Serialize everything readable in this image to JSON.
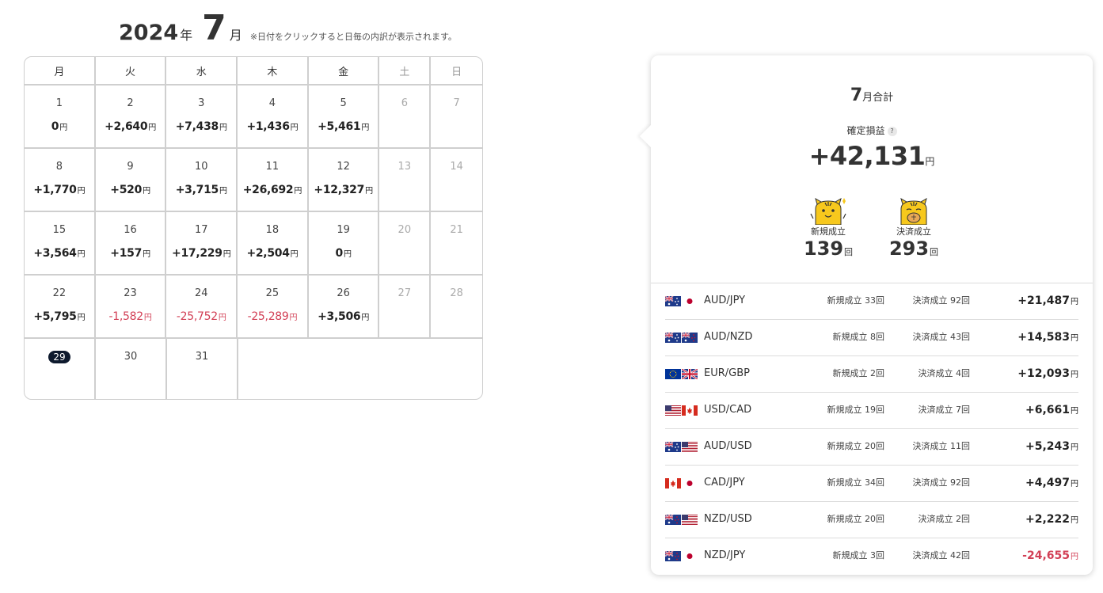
{
  "header": {
    "year": "2024",
    "year_unit": "年",
    "month": "7",
    "month_unit": "月",
    "note": "※日付をクリックすると日毎の内訳が表示されます。"
  },
  "calendar": {
    "weekdays": [
      "月",
      "火",
      "水",
      "木",
      "金",
      "土",
      "日"
    ],
    "yen": "円",
    "weeks": [
      [
        {
          "day": "1",
          "pnl": "0",
          "neg": false
        },
        {
          "day": "2",
          "pnl": "+2,640",
          "neg": false
        },
        {
          "day": "3",
          "pnl": "+7,438",
          "neg": false
        },
        {
          "day": "4",
          "pnl": "+1,436",
          "neg": false
        },
        {
          "day": "5",
          "pnl": "+5,461",
          "neg": false
        },
        {
          "day": "6",
          "pnl": "",
          "neg": false
        },
        {
          "day": "7",
          "pnl": "",
          "neg": false
        }
      ],
      [
        {
          "day": "8",
          "pnl": "+1,770",
          "neg": false
        },
        {
          "day": "9",
          "pnl": "+520",
          "neg": false
        },
        {
          "day": "10",
          "pnl": "+3,715",
          "neg": false
        },
        {
          "day": "11",
          "pnl": "+26,692",
          "neg": false
        },
        {
          "day": "12",
          "pnl": "+12,327",
          "neg": false
        },
        {
          "day": "13",
          "pnl": "",
          "neg": false
        },
        {
          "day": "14",
          "pnl": "",
          "neg": false
        }
      ],
      [
        {
          "day": "15",
          "pnl": "+3,564",
          "neg": false
        },
        {
          "day": "16",
          "pnl": "+157",
          "neg": false
        },
        {
          "day": "17",
          "pnl": "+17,229",
          "neg": false
        },
        {
          "day": "18",
          "pnl": "+2,504",
          "neg": false
        },
        {
          "day": "19",
          "pnl": "0",
          "neg": false
        },
        {
          "day": "20",
          "pnl": "",
          "neg": false
        },
        {
          "day": "21",
          "pnl": "",
          "neg": false
        }
      ],
      [
        {
          "day": "22",
          "pnl": "+5,795",
          "neg": false
        },
        {
          "day": "23",
          "pnl": "-1,582",
          "neg": true
        },
        {
          "day": "24",
          "pnl": "-25,752",
          "neg": true
        },
        {
          "day": "25",
          "pnl": "-25,289",
          "neg": true
        },
        {
          "day": "26",
          "pnl": "+3,506",
          "neg": false
        },
        {
          "day": "27",
          "pnl": "",
          "neg": false
        },
        {
          "day": "28",
          "pnl": "",
          "neg": false
        }
      ],
      [
        {
          "day": "29",
          "pnl": "",
          "neg": false,
          "today": true
        },
        {
          "day": "30",
          "pnl": "",
          "neg": false
        },
        {
          "day": "31",
          "pnl": "",
          "neg": false
        }
      ]
    ]
  },
  "summary": {
    "month": "7",
    "month_total_label": "月合計",
    "pl_label": "確定損益",
    "help_glyph": "?",
    "pl_value": "+42,131",
    "yen": "円",
    "new_label": "新規成立",
    "new_count": "139",
    "close_label": "決済成立",
    "close_count": "293",
    "count_unit": "回",
    "pairs": [
      {
        "name": "AUD/JPY",
        "flags": [
          "au",
          "jp"
        ],
        "new": "新規成立 33回",
        "close": "決済成立 92回",
        "pl": "+21,487",
        "neg": false
      },
      {
        "name": "AUD/NZD",
        "flags": [
          "au",
          "nz"
        ],
        "new": "新規成立 8回",
        "close": "決済成立 43回",
        "pl": "+14,583",
        "neg": false
      },
      {
        "name": "EUR/GBP",
        "flags": [
          "eu",
          "gb"
        ],
        "new": "新規成立 2回",
        "close": "決済成立 4回",
        "pl": "+12,093",
        "neg": false
      },
      {
        "name": "USD/CAD",
        "flags": [
          "us",
          "ca"
        ],
        "new": "新規成立 19回",
        "close": "決済成立 7回",
        "pl": "+6,661",
        "neg": false
      },
      {
        "name": "AUD/USD",
        "flags": [
          "au",
          "us"
        ],
        "new": "新規成立 20回",
        "close": "決済成立 11回",
        "pl": "+5,243",
        "neg": false
      },
      {
        "name": "CAD/JPY",
        "flags": [
          "ca",
          "jp"
        ],
        "new": "新規成立 34回",
        "close": "決済成立 92回",
        "pl": "+4,497",
        "neg": false
      },
      {
        "name": "NZD/USD",
        "flags": [
          "nz",
          "us"
        ],
        "new": "新規成立 20回",
        "close": "決済成立 2回",
        "pl": "+2,222",
        "neg": false
      },
      {
        "name": "NZD/JPY",
        "flags": [
          "nz",
          "jp"
        ],
        "new": "新規成立 3回",
        "close": "決済成立 42回",
        "pl": "-24,655",
        "neg": true
      }
    ]
  },
  "colors": {
    "negative": "#d23f55",
    "today_badge": "#0e1a2e",
    "mascot": "#f7c81d"
  }
}
